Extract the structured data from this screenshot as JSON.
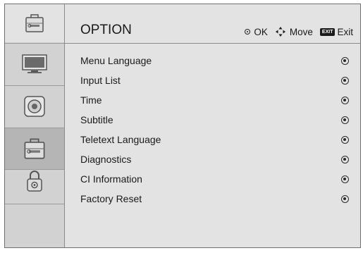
{
  "header": {
    "title": "OPTION",
    "hints": {
      "ok_label": "OK",
      "move_label": "Move",
      "exit_key_label": "EXIT",
      "exit_label": "Exit"
    }
  },
  "sidebar": {
    "items": [
      {
        "name": "picture",
        "icon": "tv-icon",
        "selected": false
      },
      {
        "name": "sound",
        "icon": "speaker-icon",
        "selected": false
      },
      {
        "name": "option",
        "icon": "toolbox-icon",
        "selected": true
      },
      {
        "name": "lock",
        "icon": "lock-icon",
        "selected": false
      }
    ]
  },
  "menu": {
    "items": [
      {
        "label": "Menu Language"
      },
      {
        "label": "Input List"
      },
      {
        "label": "Time"
      },
      {
        "label": "Subtitle"
      },
      {
        "label": "Teletext Language"
      },
      {
        "label": "Diagnostics"
      },
      {
        "label": "CI Information"
      },
      {
        "label": "Factory Reset"
      }
    ]
  },
  "colors": {
    "panel": "#e3e3e3",
    "sidebar": "#d2d2d2",
    "selected": "#b5b5b5",
    "text": "#1a1a1a"
  }
}
